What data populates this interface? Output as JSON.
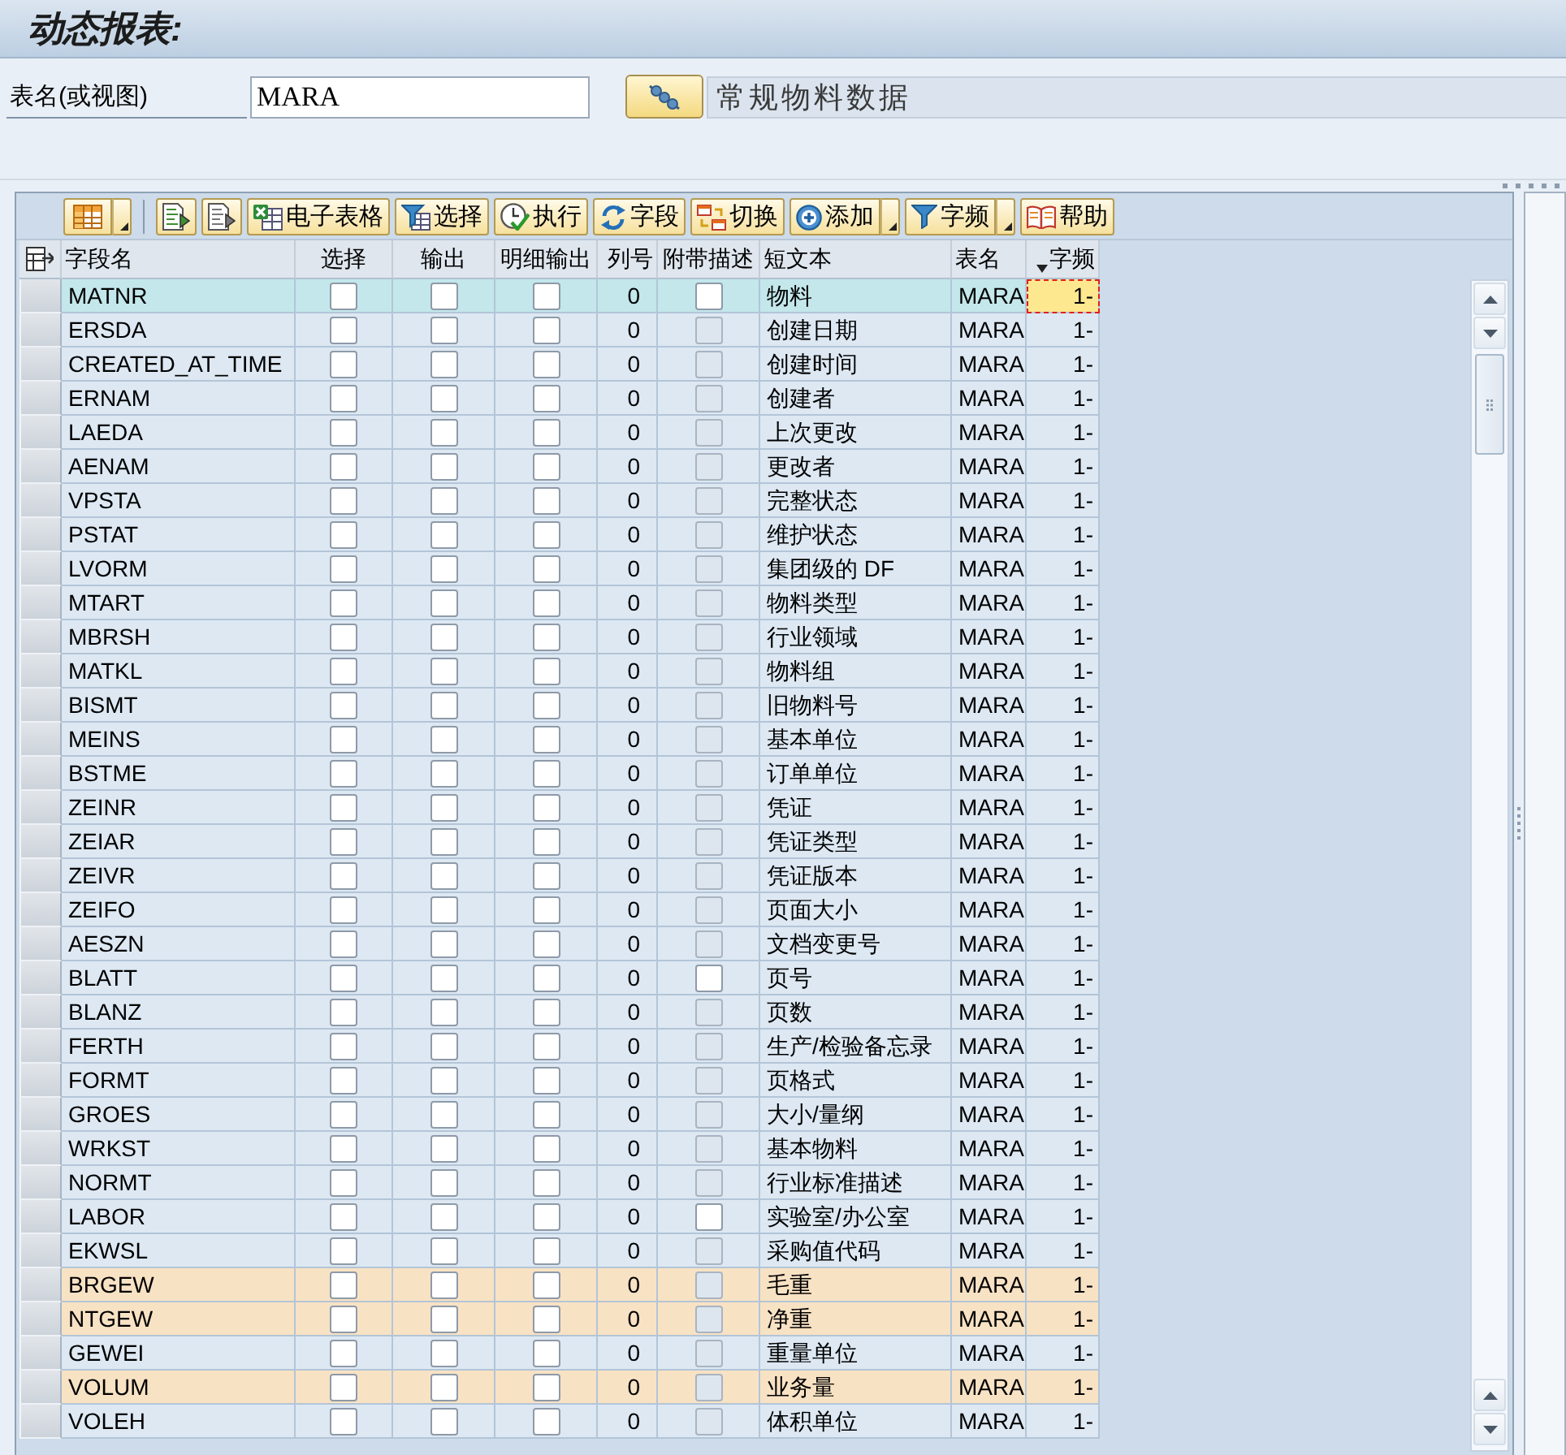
{
  "window": {
    "title": "动态报表:"
  },
  "selection": {
    "label": "表名(或视图)",
    "value": "MARA",
    "description": "常规物料数据"
  },
  "toolbar": [
    {
      "kind": "icon_menu"
    },
    {
      "kind": "separator"
    },
    {
      "kind": "icon"
    },
    {
      "kind": "icon"
    },
    {
      "kind": "button",
      "label": "电子表格"
    },
    {
      "kind": "button",
      "label": "选择"
    },
    {
      "kind": "button",
      "label": "执行"
    },
    {
      "kind": "button",
      "label": "字段"
    },
    {
      "kind": "button",
      "label": "切换"
    },
    {
      "kind": "menu_button",
      "label": "添加"
    },
    {
      "kind": "menu_button",
      "label": "字频"
    },
    {
      "kind": "button",
      "label": "帮助"
    }
  ],
  "columns": [
    {
      "label": "字段名",
      "sorted": false
    },
    {
      "label": "选择",
      "sorted": false
    },
    {
      "label": "输出",
      "sorted": false
    },
    {
      "label": "明细输出",
      "sorted": false
    },
    {
      "label": "列号",
      "sorted": false
    },
    {
      "label": "附带描述",
      "sorted": false
    },
    {
      "label": "短文本",
      "sorted": false
    },
    {
      "label": "表名",
      "sorted": false
    },
    {
      "label": "字频",
      "sorted": true
    }
  ],
  "rows": [
    {
      "name": "MATNR",
      "select": false,
      "output": false,
      "detail": false,
      "col_no": "0",
      "with_desc": {
        "checked": false,
        "disabled": false
      },
      "short_text": "物料",
      "table": "MARA",
      "freq": "1-",
      "selected": true,
      "highlighted": false,
      "freq_focused": true
    },
    {
      "name": "ERSDA",
      "select": false,
      "output": false,
      "detail": false,
      "col_no": "0",
      "with_desc": {
        "checked": false,
        "disabled": true
      },
      "short_text": "创建日期",
      "table": "MARA",
      "freq": "1-",
      "selected": false,
      "highlighted": false,
      "freq_focused": false
    },
    {
      "name": "CREATED_AT_TIME",
      "select": false,
      "output": false,
      "detail": false,
      "col_no": "0",
      "with_desc": {
        "checked": false,
        "disabled": true
      },
      "short_text": "创建时间",
      "table": "MARA",
      "freq": "1-",
      "selected": false,
      "highlighted": false,
      "freq_focused": false
    },
    {
      "name": "ERNAM",
      "select": false,
      "output": false,
      "detail": false,
      "col_no": "0",
      "with_desc": {
        "checked": false,
        "disabled": true
      },
      "short_text": "创建者",
      "table": "MARA",
      "freq": "1-",
      "selected": false,
      "highlighted": false,
      "freq_focused": false
    },
    {
      "name": "LAEDA",
      "select": false,
      "output": false,
      "detail": false,
      "col_no": "0",
      "with_desc": {
        "checked": false,
        "disabled": true
      },
      "short_text": "上次更改",
      "table": "MARA",
      "freq": "1-",
      "selected": false,
      "highlighted": false,
      "freq_focused": false
    },
    {
      "name": "AENAM",
      "select": false,
      "output": false,
      "detail": false,
      "col_no": "0",
      "with_desc": {
        "checked": false,
        "disabled": true
      },
      "short_text": "更改者",
      "table": "MARA",
      "freq": "1-",
      "selected": false,
      "highlighted": false,
      "freq_focused": false
    },
    {
      "name": "VPSTA",
      "select": false,
      "output": false,
      "detail": false,
      "col_no": "0",
      "with_desc": {
        "checked": false,
        "disabled": true
      },
      "short_text": "完整状态",
      "table": "MARA",
      "freq": "1-",
      "selected": false,
      "highlighted": false,
      "freq_focused": false
    },
    {
      "name": "PSTAT",
      "select": false,
      "output": false,
      "detail": false,
      "col_no": "0",
      "with_desc": {
        "checked": false,
        "disabled": true
      },
      "short_text": "维护状态",
      "table": "MARA",
      "freq": "1-",
      "selected": false,
      "highlighted": false,
      "freq_focused": false
    },
    {
      "name": "LVORM",
      "select": false,
      "output": false,
      "detail": false,
      "col_no": "0",
      "with_desc": {
        "checked": false,
        "disabled": true
      },
      "short_text": "集团级的 DF",
      "table": "MARA",
      "freq": "1-",
      "selected": false,
      "highlighted": false,
      "freq_focused": false
    },
    {
      "name": "MTART",
      "select": false,
      "output": false,
      "detail": false,
      "col_no": "0",
      "with_desc": {
        "checked": false,
        "disabled": true
      },
      "short_text": "物料类型",
      "table": "MARA",
      "freq": "1-",
      "selected": false,
      "highlighted": false,
      "freq_focused": false
    },
    {
      "name": "MBRSH",
      "select": false,
      "output": false,
      "detail": false,
      "col_no": "0",
      "with_desc": {
        "checked": false,
        "disabled": true
      },
      "short_text": "行业领域",
      "table": "MARA",
      "freq": "1-",
      "selected": false,
      "highlighted": false,
      "freq_focused": false
    },
    {
      "name": "MATKL",
      "select": false,
      "output": false,
      "detail": false,
      "col_no": "0",
      "with_desc": {
        "checked": false,
        "disabled": true
      },
      "short_text": "物料组",
      "table": "MARA",
      "freq": "1-",
      "selected": false,
      "highlighted": false,
      "freq_focused": false
    },
    {
      "name": "BISMT",
      "select": false,
      "output": false,
      "detail": false,
      "col_no": "0",
      "with_desc": {
        "checked": false,
        "disabled": true
      },
      "short_text": "旧物料号",
      "table": "MARA",
      "freq": "1-",
      "selected": false,
      "highlighted": false,
      "freq_focused": false
    },
    {
      "name": "MEINS",
      "select": false,
      "output": false,
      "detail": false,
      "col_no": "0",
      "with_desc": {
        "checked": false,
        "disabled": true
      },
      "short_text": "基本单位",
      "table": "MARA",
      "freq": "1-",
      "selected": false,
      "highlighted": false,
      "freq_focused": false
    },
    {
      "name": "BSTME",
      "select": false,
      "output": false,
      "detail": false,
      "col_no": "0",
      "with_desc": {
        "checked": false,
        "disabled": true
      },
      "short_text": "订单单位",
      "table": "MARA",
      "freq": "1-",
      "selected": false,
      "highlighted": false,
      "freq_focused": false
    },
    {
      "name": "ZEINR",
      "select": false,
      "output": false,
      "detail": false,
      "col_no": "0",
      "with_desc": {
        "checked": false,
        "disabled": true
      },
      "short_text": "凭证",
      "table": "MARA",
      "freq": "1-",
      "selected": false,
      "highlighted": false,
      "freq_focused": false
    },
    {
      "name": "ZEIAR",
      "select": false,
      "output": false,
      "detail": false,
      "col_no": "0",
      "with_desc": {
        "checked": false,
        "disabled": true
      },
      "short_text": "凭证类型",
      "table": "MARA",
      "freq": "1-",
      "selected": false,
      "highlighted": false,
      "freq_focused": false
    },
    {
      "name": "ZEIVR",
      "select": false,
      "output": false,
      "detail": false,
      "col_no": "0",
      "with_desc": {
        "checked": false,
        "disabled": true
      },
      "short_text": "凭证版本",
      "table": "MARA",
      "freq": "1-",
      "selected": false,
      "highlighted": false,
      "freq_focused": false
    },
    {
      "name": "ZEIFO",
      "select": false,
      "output": false,
      "detail": false,
      "col_no": "0",
      "with_desc": {
        "checked": false,
        "disabled": true
      },
      "short_text": "页面大小",
      "table": "MARA",
      "freq": "1-",
      "selected": false,
      "highlighted": false,
      "freq_focused": false
    },
    {
      "name": "AESZN",
      "select": false,
      "output": false,
      "detail": false,
      "col_no": "0",
      "with_desc": {
        "checked": false,
        "disabled": true
      },
      "short_text": "文档变更号",
      "table": "MARA",
      "freq": "1-",
      "selected": false,
      "highlighted": false,
      "freq_focused": false
    },
    {
      "name": "BLATT",
      "select": false,
      "output": false,
      "detail": false,
      "col_no": "0",
      "with_desc": {
        "checked": false,
        "disabled": false
      },
      "short_text": "页号",
      "table": "MARA",
      "freq": "1-",
      "selected": false,
      "highlighted": false,
      "freq_focused": false
    },
    {
      "name": "BLANZ",
      "select": false,
      "output": false,
      "detail": false,
      "col_no": "0",
      "with_desc": {
        "checked": false,
        "disabled": true
      },
      "short_text": "页数",
      "table": "MARA",
      "freq": "1-",
      "selected": false,
      "highlighted": false,
      "freq_focused": false
    },
    {
      "name": "FERTH",
      "select": false,
      "output": false,
      "detail": false,
      "col_no": "0",
      "with_desc": {
        "checked": false,
        "disabled": true
      },
      "short_text": "生产/检验备忘录",
      "table": "MARA",
      "freq": "1-",
      "selected": false,
      "highlighted": false,
      "freq_focused": false
    },
    {
      "name": "FORMT",
      "select": false,
      "output": false,
      "detail": false,
      "col_no": "0",
      "with_desc": {
        "checked": false,
        "disabled": true
      },
      "short_text": "页格式",
      "table": "MARA",
      "freq": "1-",
      "selected": false,
      "highlighted": false,
      "freq_focused": false
    },
    {
      "name": "GROES",
      "select": false,
      "output": false,
      "detail": false,
      "col_no": "0",
      "with_desc": {
        "checked": false,
        "disabled": true
      },
      "short_text": "大小/量纲",
      "table": "MARA",
      "freq": "1-",
      "selected": false,
      "highlighted": false,
      "freq_focused": false
    },
    {
      "name": "WRKST",
      "select": false,
      "output": false,
      "detail": false,
      "col_no": "0",
      "with_desc": {
        "checked": false,
        "disabled": true
      },
      "short_text": "基本物料",
      "table": "MARA",
      "freq": "1-",
      "selected": false,
      "highlighted": false,
      "freq_focused": false
    },
    {
      "name": "NORMT",
      "select": false,
      "output": false,
      "detail": false,
      "col_no": "0",
      "with_desc": {
        "checked": false,
        "disabled": true
      },
      "short_text": "行业标准描述",
      "table": "MARA",
      "freq": "1-",
      "selected": false,
      "highlighted": false,
      "freq_focused": false
    },
    {
      "name": "LABOR",
      "select": false,
      "output": false,
      "detail": false,
      "col_no": "0",
      "with_desc": {
        "checked": false,
        "disabled": false
      },
      "short_text": "实验室/办公室",
      "table": "MARA",
      "freq": "1-",
      "selected": false,
      "highlighted": false,
      "freq_focused": false
    },
    {
      "name": "EKWSL",
      "select": false,
      "output": false,
      "detail": false,
      "col_no": "0",
      "with_desc": {
        "checked": false,
        "disabled": true
      },
      "short_text": "采购值代码",
      "table": "MARA",
      "freq": "1-",
      "selected": false,
      "highlighted": false,
      "freq_focused": false
    },
    {
      "name": "BRGEW",
      "select": false,
      "output": false,
      "detail": false,
      "col_no": "0",
      "with_desc": {
        "checked": false,
        "disabled": true
      },
      "short_text": "毛重",
      "table": "MARA",
      "freq": "1-",
      "selected": false,
      "highlighted": true,
      "freq_focused": false
    },
    {
      "name": "NTGEW",
      "select": false,
      "output": false,
      "detail": false,
      "col_no": "0",
      "with_desc": {
        "checked": false,
        "disabled": true
      },
      "short_text": "净重",
      "table": "MARA",
      "freq": "1-",
      "selected": false,
      "highlighted": true,
      "freq_focused": false
    },
    {
      "name": "GEWEI",
      "select": false,
      "output": false,
      "detail": false,
      "col_no": "0",
      "with_desc": {
        "checked": false,
        "disabled": true
      },
      "short_text": "重量单位",
      "table": "MARA",
      "freq": "1-",
      "selected": false,
      "highlighted": false,
      "freq_focused": false
    },
    {
      "name": "VOLUM",
      "select": false,
      "output": false,
      "detail": false,
      "col_no": "0",
      "with_desc": {
        "checked": false,
        "disabled": true
      },
      "short_text": "业务量",
      "table": "MARA",
      "freq": "1-",
      "selected": false,
      "highlighted": true,
      "freq_focused": false
    },
    {
      "name": "VOLEH",
      "select": false,
      "output": false,
      "detail": false,
      "col_no": "0",
      "with_desc": {
        "checked": false,
        "disabled": true
      },
      "short_text": "体积单位",
      "table": "MARA",
      "freq": "1-",
      "selected": false,
      "highlighted": false,
      "freq_focused": false
    }
  ]
}
